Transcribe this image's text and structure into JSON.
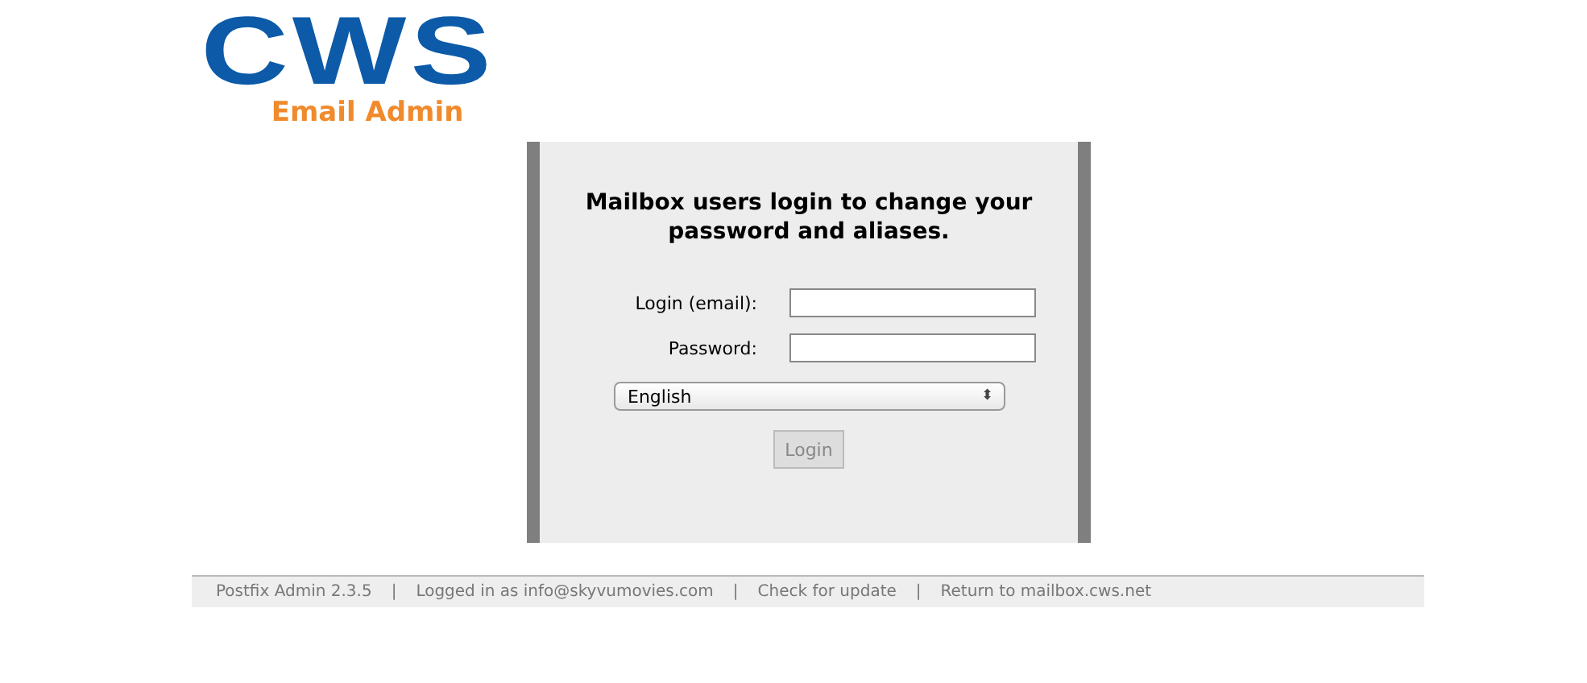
{
  "logo": {
    "brand": "CWS",
    "subtitle": "Email Admin"
  },
  "login_panel": {
    "heading": "Mailbox users login to change your password and aliases.",
    "fields": [
      {
        "label": "Login (email):"
      },
      {
        "label": "Password:"
      }
    ],
    "language_select": {
      "value": "English",
      "arrows": "⬍"
    },
    "login_button": {
      "label": "Login",
      "disabled": true
    }
  },
  "footer": {
    "items": [
      {
        "kind": "text",
        "text": "Postfix Admin 2.3.5"
      },
      {
        "kind": "separator",
        "text": "|"
      },
      {
        "kind": "text",
        "text": "Logged in as info@skyvumovies.com"
      },
      {
        "kind": "separator",
        "text": "|"
      },
      {
        "kind": "link",
        "text": "Check for update"
      },
      {
        "kind": "separator",
        "text": "|"
      },
      {
        "kind": "link",
        "text": "Return to mailbox.cws.net"
      }
    ]
  }
}
